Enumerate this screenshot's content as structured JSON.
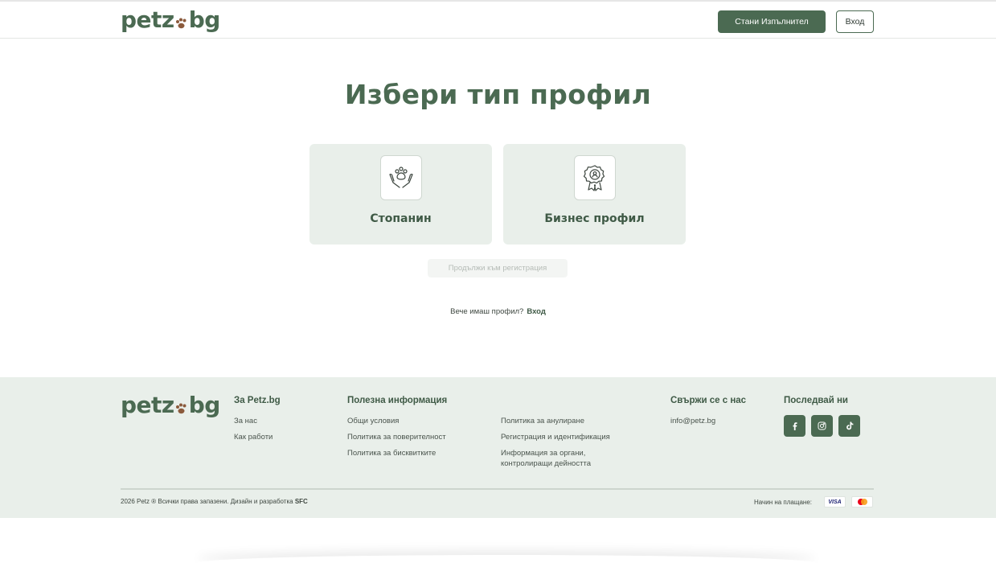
{
  "header": {
    "logo": {
      "left": "petz",
      "right": "bg"
    },
    "become_performer": "Стани Изпълнител",
    "login": "Вход"
  },
  "main": {
    "title": "Избери тип профил",
    "cards": [
      {
        "label": "Стопанин",
        "icon": "paw-hands-icon"
      },
      {
        "label": "Бизнес профил",
        "icon": "award-badge-icon"
      }
    ],
    "continue": "Продължи към регистрация",
    "have_account": "Вече имаш профил?",
    "have_account_link": "Вход"
  },
  "footer": {
    "logo": {
      "left": "petz",
      "right": "bg"
    },
    "about": {
      "heading": "За Petz.bg",
      "links": [
        "За нас",
        "Как работи"
      ]
    },
    "useful": {
      "heading": "Полезна информация",
      "col1": [
        "Общи условия",
        "Политика за поверителност",
        "Политика за бисквитките"
      ],
      "col2": [
        "Политика за анулиране",
        "Регистрация и идентификация",
        "Информация за органи, контролиращи дейността"
      ]
    },
    "contact": {
      "heading": "Свържи се с нас",
      "email": "info@petz.bg"
    },
    "follow": {
      "heading": "Последвай ни",
      "icons": [
        "facebook-icon",
        "instagram-icon",
        "tiktok-icon"
      ]
    },
    "copyright": "2026 Petz ® Всички права запазени. Дизайн и разработка",
    "copyright_brand": "SFC",
    "payment_label": "Начин на плащане:",
    "payment_visa": "VISA"
  },
  "colors": {
    "brand": "#4b6a52",
    "card_bg": "#e9efea",
    "paw": "#8b5a3c"
  }
}
